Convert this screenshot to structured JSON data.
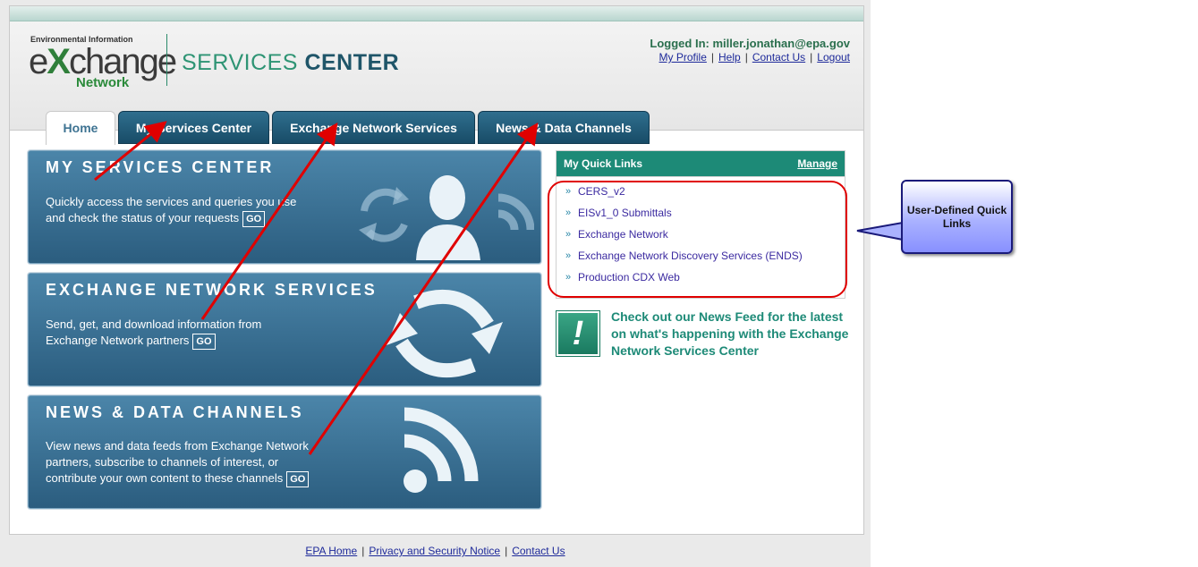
{
  "header": {
    "logo_top": "Environmental Information",
    "logo_main": "change",
    "logo_x": "X",
    "logo_pre": "e",
    "logo_bottom": "Network",
    "title_light": "SERVICES",
    "title_bold": "CENTER",
    "logged_in": "Logged In: miller.jonathan@epa.gov",
    "links": [
      "My Profile",
      "Help",
      "Contact Us",
      "Logout"
    ]
  },
  "tabs": [
    "Home",
    "My Services Center",
    "Exchange Network Services",
    "News & Data Channels"
  ],
  "panels": [
    {
      "title": "MY SERVICES CENTER",
      "line1": "Quickly access the services and queries you use",
      "line2": "and check the status of your requests",
      "go": "GO"
    },
    {
      "title": "EXCHANGE NETWORK SERVICES",
      "line1": "Send, get, and download information from",
      "line2": "Exchange Network partners",
      "go": "GO"
    },
    {
      "title": "NEWS & DATA CHANNELS",
      "line1": "View news and data feeds from Exchange Network",
      "line2": "partners, subscribe to channels of interest, or",
      "line3": "contribute your own content to these channels",
      "go": "GO"
    }
  ],
  "quick_links": {
    "title": "My Quick Links",
    "manage": "Manage",
    "items": [
      "CERS_v2",
      "EISv1_0 Submittals",
      "Exchange Network",
      "Exchange Network Discovery Services (ENDS)",
      "Production CDX Web"
    ]
  },
  "news_feed": "Check out our News Feed for the latest on what's happening with the Exchange Network Services Center",
  "footer": [
    "EPA Home",
    "Privacy and Security Notice",
    "Contact Us"
  ],
  "callout": "User-Defined Quick Links",
  "colors": {
    "accent": "#1d8a77",
    "tab": "#1e5573",
    "annotation": "#e00000",
    "link": "#1e2a9a"
  }
}
